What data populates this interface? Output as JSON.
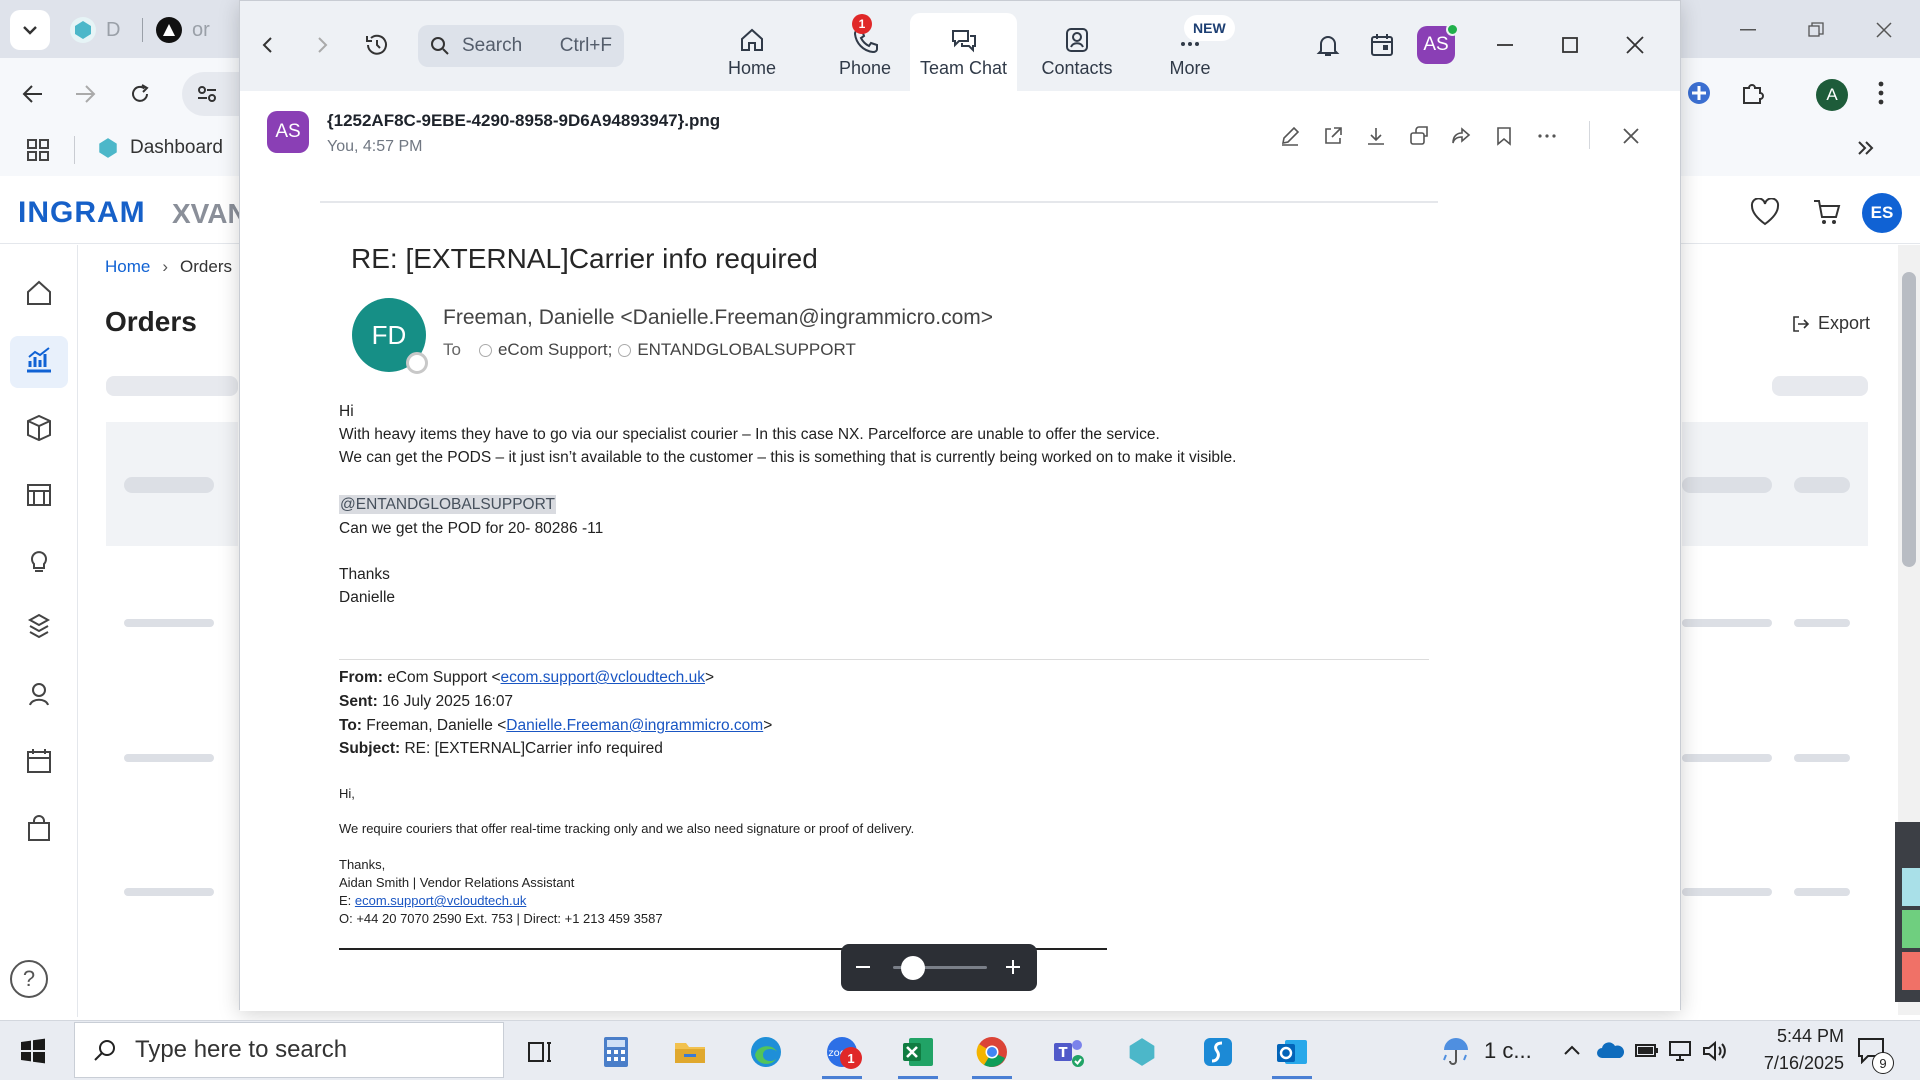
{
  "browser": {
    "tabs": [
      {
        "label": "D"
      },
      {
        "label": "or"
      }
    ],
    "bookmarks": {
      "dashboard_label": "Dashboard"
    },
    "profile_initial": "A"
  },
  "site": {
    "logo_text_a": "INGRAM",
    "logo_text_b": "XVAN",
    "breadcrumb": {
      "home": "Home",
      "separator": "›",
      "current": "Orders"
    },
    "page_title": "Orders",
    "export_label": "Export",
    "user_initials": "ES"
  },
  "zoom": {
    "search": {
      "placeholder": "Search",
      "shortcut": "Ctrl+F"
    },
    "nav": [
      {
        "label": "Home"
      },
      {
        "label": "Phone",
        "badge": "1"
      },
      {
        "label": "Team Chat"
      },
      {
        "label": "Contacts"
      },
      {
        "label": "More",
        "badge": "NEW"
      }
    ],
    "user_initials": "AS",
    "file": {
      "name": "{1252AF8C-9EBE-4290-8958-9D6A94893947}.png",
      "meta": "You, 4:57 PM"
    }
  },
  "email": {
    "subject": "RE: [EXTERNAL]Carrier info required",
    "sender_initials": "FD",
    "sender": "Freeman, Danielle <Danielle.Freeman@ingrammicro.com>",
    "to_label": "To",
    "recipients": [
      "eCom Support;",
      "ENTANDGLOBALSUPPORT"
    ],
    "body": {
      "greeting": "Hi",
      "line1": "With heavy items they have to go via our specialist courier – In this case NX. Parcelforce are unable to offer the service.",
      "line2": "We can get the PODS – it just isn’t available to the customer – this is something that is currently being worked on to make it visible.",
      "mention": "@ENTANDGLOBALSUPPORT",
      "line3": "Can we get the POD for 20- 80286 -11",
      "thanks": "Thanks",
      "signoff": "Danielle"
    },
    "quoted": {
      "from_label": "From:",
      "from_name": "eCom Support <",
      "from_email": "ecom.support@vcloudtech.uk",
      "from_close": ">",
      "sent_label": "Sent:",
      "sent_value": "16 July 2025 16:07",
      "to_label": "To:",
      "to_name": "Freeman, Danielle <",
      "to_email": "Danielle.Freeman@ingrammicro.com",
      "to_close": ">",
      "subject_label": "Subject:",
      "subject_value": "RE: [EXTERNAL]Carrier info required",
      "greeting": "Hi,",
      "body": "We require couriers that offer real-time tracking only and we also need signature or proof of delivery.",
      "thanks": "Thanks,",
      "sig_name": "Aidan Smith | Vendor Relations Assistant",
      "sig_email_label": "E: ",
      "sig_email": "ecom.support@vcloudtech.uk",
      "sig_phone": "O:  +44 20 7070 2590 Ext. 753 | Direct: +1 213 459 3587"
    }
  },
  "taskbar": {
    "search_placeholder": "Type here to search",
    "zoom_badge": "1",
    "weather": "1 c...",
    "time": "5:44 PM",
    "date": "7/16/2025",
    "notification_count": "9"
  }
}
